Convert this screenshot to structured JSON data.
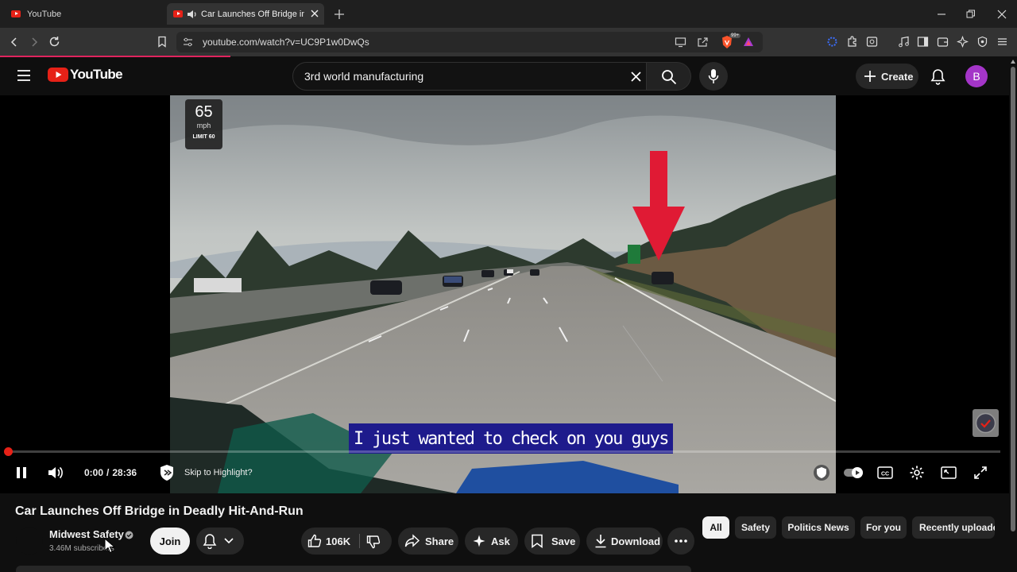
{
  "browser": {
    "tabs": [
      {
        "title": "YouTube",
        "active": false
      },
      {
        "title": "Car Launches Off Bridge in De",
        "active": true
      }
    ],
    "url": "youtube.com/watch?v=UC9P1w0DwQs",
    "brave_badge": "99+"
  },
  "youtube": {
    "logo_text": "YouTube",
    "search_value": "3rd world manufacturing",
    "create_label": "Create",
    "avatar_letter": "B"
  },
  "player": {
    "speed_value": "65",
    "speed_unit": "mph",
    "speed_limit": "LIMIT 60",
    "caption": "I just wanted to check on you guys",
    "time_current": "0:00",
    "time_separator": "/",
    "time_total": "28:36",
    "skip_label": "Skip to Highlight?",
    "progress_fraction": 0.003
  },
  "video": {
    "title": "Car Launches Off Bridge in Deadly Hit-And-Run",
    "channel": "Midwest Safety",
    "subscribers": "3.46M subscribers",
    "join_label": "Join",
    "likes": "106K",
    "share_label": "Share",
    "ask_label": "Ask",
    "save_label": "Save",
    "download_label": "Download"
  },
  "chips": [
    "All",
    "Safety",
    "Politics News",
    "For you",
    "Recently uploade"
  ],
  "colors": {
    "accent_red": "#e62117",
    "loading_bar": "#e0245e",
    "avatar": "#a435c8",
    "caption_bg": "#1e1b8c"
  }
}
